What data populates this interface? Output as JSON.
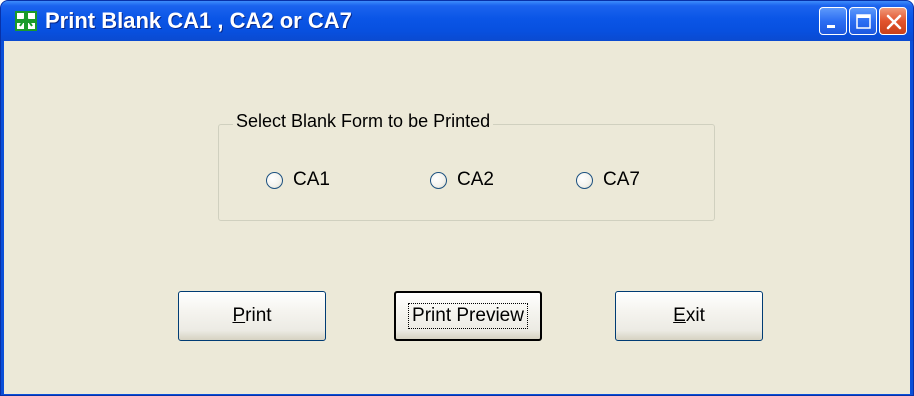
{
  "window": {
    "title": "Print Blank CA1 , CA2 or CA7",
    "app_icon": "green-cross-icon",
    "controls": [
      "minimize-icon",
      "maximize-icon",
      "close-icon"
    ]
  },
  "form_group": {
    "legend": "Select Blank Form to be Printed",
    "options": [
      {
        "label": "CA1",
        "selected": false
      },
      {
        "label": "CA2",
        "selected": false
      },
      {
        "label": "CA7",
        "selected": false
      }
    ]
  },
  "buttons": {
    "print": {
      "mnemonic": "P",
      "rest": "rint"
    },
    "print_preview": {
      "label": "Print Preview",
      "focused": true
    },
    "exit": {
      "mnemonic": "E",
      "rest": "xit"
    }
  },
  "colors": {
    "titlebar": "#0a55e6",
    "client_background": "#ece9d8",
    "close_button": "#e2542d",
    "app_icon_green": "#1a9a2a"
  }
}
